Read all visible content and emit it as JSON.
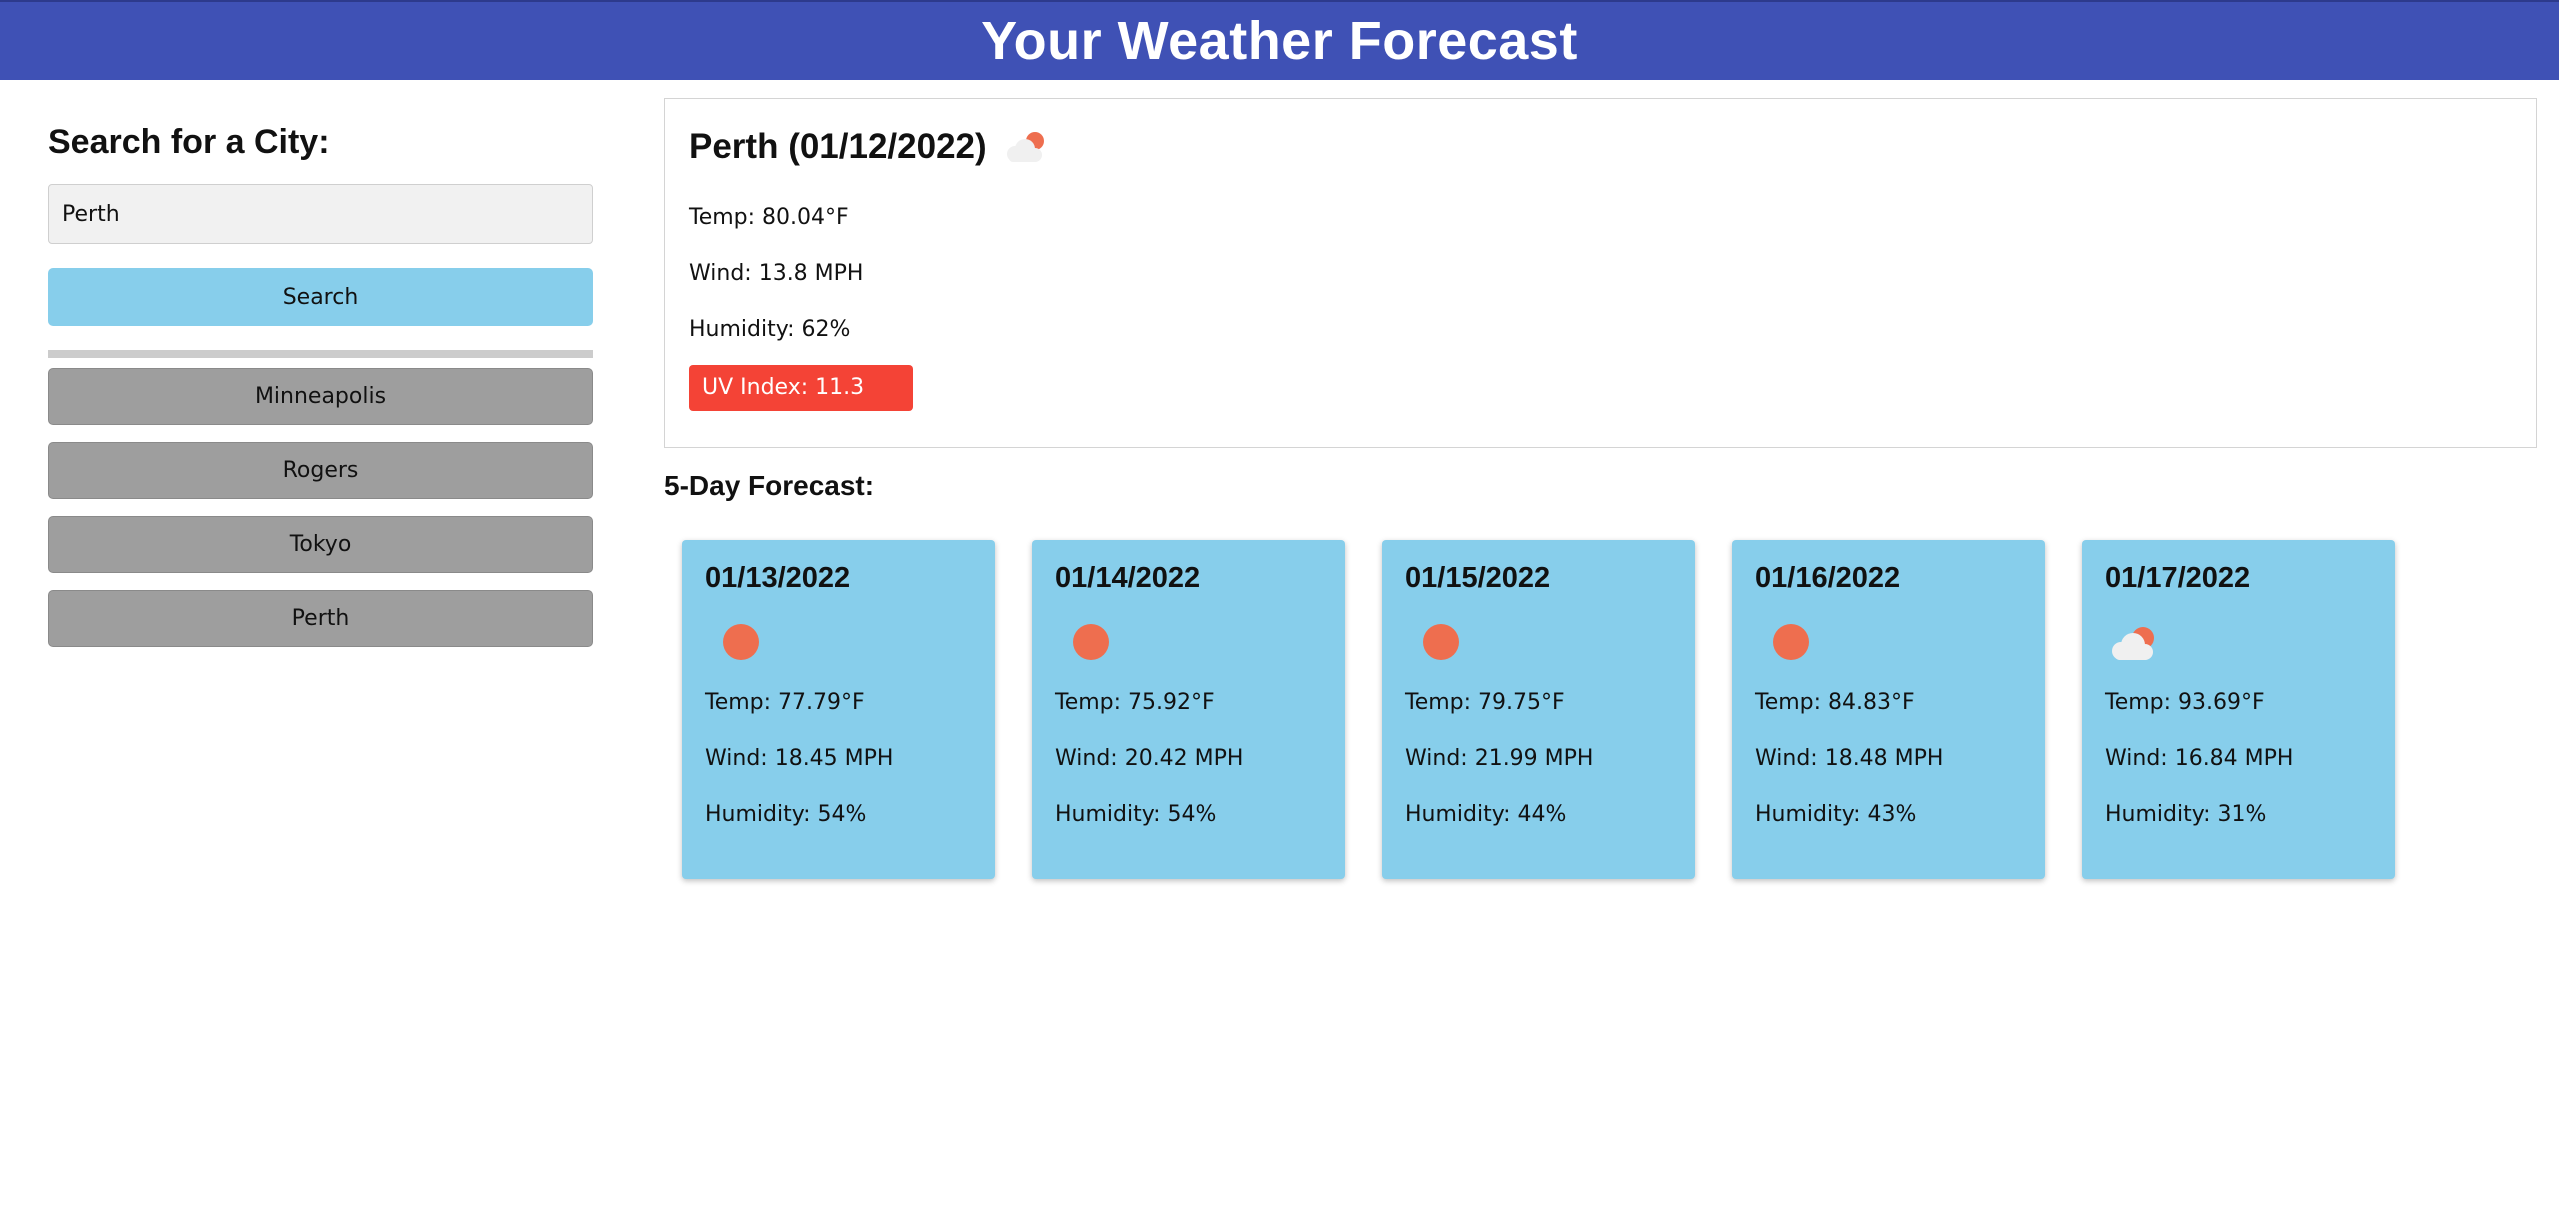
{
  "header": {
    "title": "Your Weather Forecast"
  },
  "sidebar": {
    "heading": "Search for a City:",
    "search_value": "Perth",
    "search_button": "Search",
    "history": [
      "Minneapolis",
      "Rogers",
      "Tokyo",
      "Perth"
    ]
  },
  "current": {
    "title": "Perth (01/12/2022)",
    "icon": "few-clouds-icon",
    "temp": "Temp: 80.04°F",
    "wind": "Wind: 13.8 MPH",
    "humidity": "Humidity: 62%",
    "uv": "UV Index: 11.3",
    "uv_color": "#f44336"
  },
  "forecast": {
    "heading": "5-Day Forecast:",
    "days": [
      {
        "date": "01/13/2022",
        "icon": "clear-sky-icon",
        "temp": "Temp: 77.79°F",
        "wind": "Wind: 18.45 MPH",
        "humidity": "Humidity: 54%"
      },
      {
        "date": "01/14/2022",
        "icon": "clear-sky-icon",
        "temp": "Temp: 75.92°F",
        "wind": "Wind: 20.42 MPH",
        "humidity": "Humidity: 54%"
      },
      {
        "date": "01/15/2022",
        "icon": "clear-sky-icon",
        "temp": "Temp: 79.75°F",
        "wind": "Wind: 21.99 MPH",
        "humidity": "Humidity: 44%"
      },
      {
        "date": "01/16/2022",
        "icon": "clear-sky-icon",
        "temp": "Temp: 84.83°F",
        "wind": "Wind: 18.48 MPH",
        "humidity": "Humidity: 43%"
      },
      {
        "date": "01/17/2022",
        "icon": "few-clouds-icon",
        "temp": "Temp: 93.69°F",
        "wind": "Wind: 16.84 MPH",
        "humidity": "Humidity: 31%"
      }
    ]
  },
  "colors": {
    "header_bg": "#3f51b5",
    "card_bg": "#87ceeb",
    "history_bg": "#9e9e9e",
    "sun": "#ee6e4f",
    "cloud": "#eeeeee"
  }
}
